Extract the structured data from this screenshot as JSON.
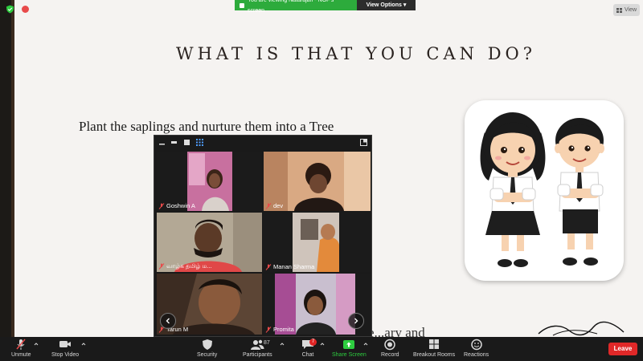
{
  "top": {
    "recording_label": "",
    "banner_text": "You are viewing Natarajan - NOF's screen",
    "view_options_label": "View Options",
    "view_label": "View",
    "banner_color": "#2dab3c"
  },
  "slide": {
    "title": "WHAT IS THAT YOU CAN DO?",
    "body": "Plant the saplings and nurture them into a Tree",
    "peek_text": "e...ary and"
  },
  "gallery": {
    "participants": [
      {
        "name": "Goshwin A",
        "muted": true
      },
      {
        "name": "dev",
        "muted": true
      },
      {
        "name": "வாழ்க தமிழ் ம...",
        "muted": true
      },
      {
        "name": "Manan Sharma",
        "muted": true
      },
      {
        "name": "Tarun M",
        "muted": true
      },
      {
        "name": "Promita",
        "muted": true
      }
    ]
  },
  "toolbar": {
    "unmute_label": "Unmute",
    "stop_video_label": "Stop Video",
    "security_label": "Security",
    "participants_label": "Participants",
    "participants_count": "87",
    "chat_label": "Chat",
    "chat_badge": "7",
    "share_screen_label": "Share Screen",
    "record_label": "Record",
    "breakout_label": "Breakout Rooms",
    "reactions_label": "Reactions",
    "leave_label": "Leave",
    "leave_color": "#e02828",
    "share_color": "#2dcc3f"
  }
}
